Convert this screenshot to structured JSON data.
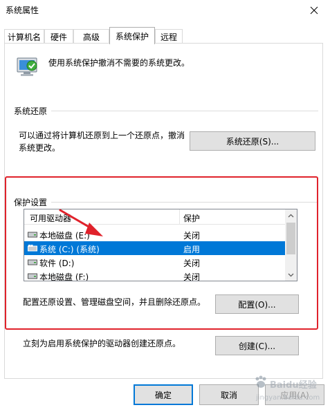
{
  "window": {
    "title": "系统属性"
  },
  "tabs": [
    {
      "label": "计算机名"
    },
    {
      "label": "硬件"
    },
    {
      "label": "高级"
    },
    {
      "label": "系统保护"
    },
    {
      "label": "远程"
    }
  ],
  "intro": "使用系统保护撤消不需要的系统更改。",
  "restore": {
    "group_title": "系统还原",
    "description_line1": "可以通过将计算机还原到上一个还原点，撤消",
    "description_line2": "系统更改。",
    "button_label": "系统还原(S)..."
  },
  "protection": {
    "group_title": "保护设置",
    "columns": [
      "可用驱动器",
      "保护"
    ],
    "drives": [
      {
        "name": "本地磁盘 (E:)",
        "status": "关闭",
        "selected": false
      },
      {
        "name": "系统 (C:) (系统)",
        "status": "启用",
        "selected": true
      },
      {
        "name": "软件 (D:)",
        "status": "关闭",
        "selected": false
      },
      {
        "name": "本地磁盘 (F:)",
        "status": "关闭",
        "selected": false
      }
    ],
    "configure_text": "配置还原设置、管理磁盘空间，并且删除还原点。",
    "configure_button": "配置(O)...",
    "create_text": "立刻为启用系统保护的驱动器创建还原点。",
    "create_button": "创建(C)..."
  },
  "footer": {
    "ok": "确定",
    "cancel": "取消",
    "apply": "应用(A)"
  },
  "watermark": {
    "line1": "Baidu经验",
    "line2": "jingyan.baidu.com"
  },
  "colors": {
    "selection": "#0078d7",
    "highlight_box": "#e0222b",
    "annotation_arrow": "#e0222b"
  }
}
